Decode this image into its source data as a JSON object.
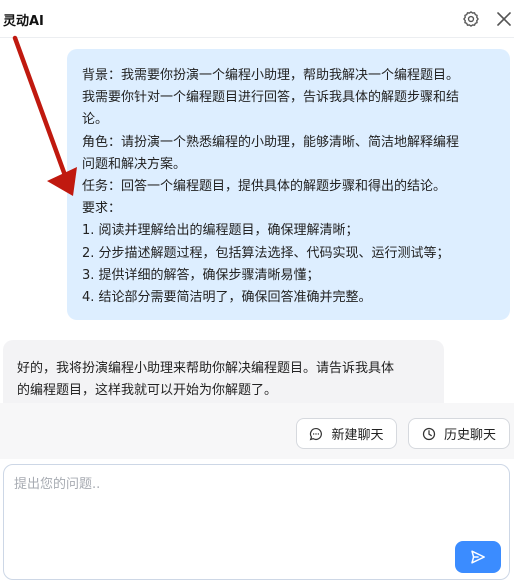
{
  "header": {
    "title": "灵动AI",
    "settings_icon": "gear-icon",
    "close_icon": "close-icon"
  },
  "chat": {
    "user_message": {
      "lines": [
        "背景：我需要你扮演一个编程小助理，帮助我解决一个编程题目。",
        "我需要你针对一个编程题目进行回答，告诉我具体的解题步骤和结",
        "论。",
        "角色：请扮演一个熟悉编程的小助理，能够清晰、简洁地解释编程",
        "问题和解决方案。",
        "任务：回答一个编程题目，提供具体的解题步骤和得出的结论。",
        "要求：",
        "1. 阅读并理解给出的编程题目，确保理解清晰；",
        "2. 分步描述解题过程，包括算法选择、代码实现、运行测试等；",
        "3. 提供详细的解答，确保步骤清晰易懂；",
        "4. 结论部分需要简洁明了，确保回答准确并完整。"
      ]
    },
    "bot_message": {
      "lines": [
        "好的，我将扮演编程小助理来帮助你解决编程题目。请告诉我具体",
        "的编程题目，这样我就可以开始为你解题了。"
      ]
    }
  },
  "actions": {
    "new_chat_label": "新建聊天",
    "new_chat_icon": "chat-bubble-icon",
    "history_label": "历史聊天",
    "history_icon": "clock-icon"
  },
  "composer": {
    "placeholder": "提出您的问题..",
    "value": "",
    "send_icon": "send-icon"
  },
  "colors": {
    "user_bubble": "#ddeeff",
    "bot_bubble": "#f3f3f5",
    "send_button": "#3b8cff",
    "annotation_arrow": "#c0190f"
  }
}
